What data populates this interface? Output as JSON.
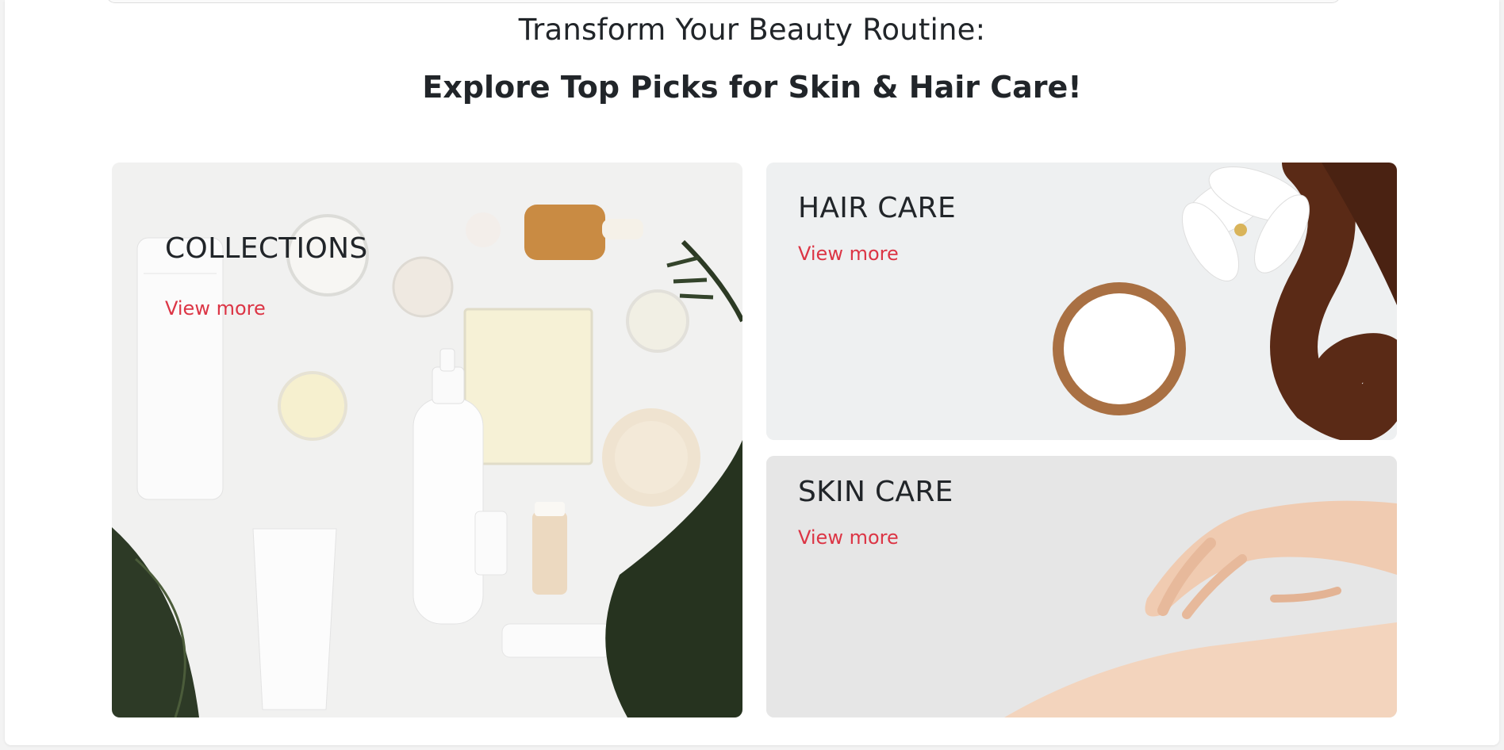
{
  "heading": {
    "line1": "Transform Your Beauty Routine:",
    "line2": "Explore Top Picks for Skin & Hair Care!"
  },
  "cards": {
    "collections": {
      "title": "COLLECTIONS",
      "link": "View more"
    },
    "hair": {
      "title": "HAIR CARE",
      "link": "View more"
    },
    "skin": {
      "title": "SKIN CARE",
      "link": "View more"
    }
  },
  "colors": {
    "link": "#dc3545",
    "text": "#212529"
  }
}
